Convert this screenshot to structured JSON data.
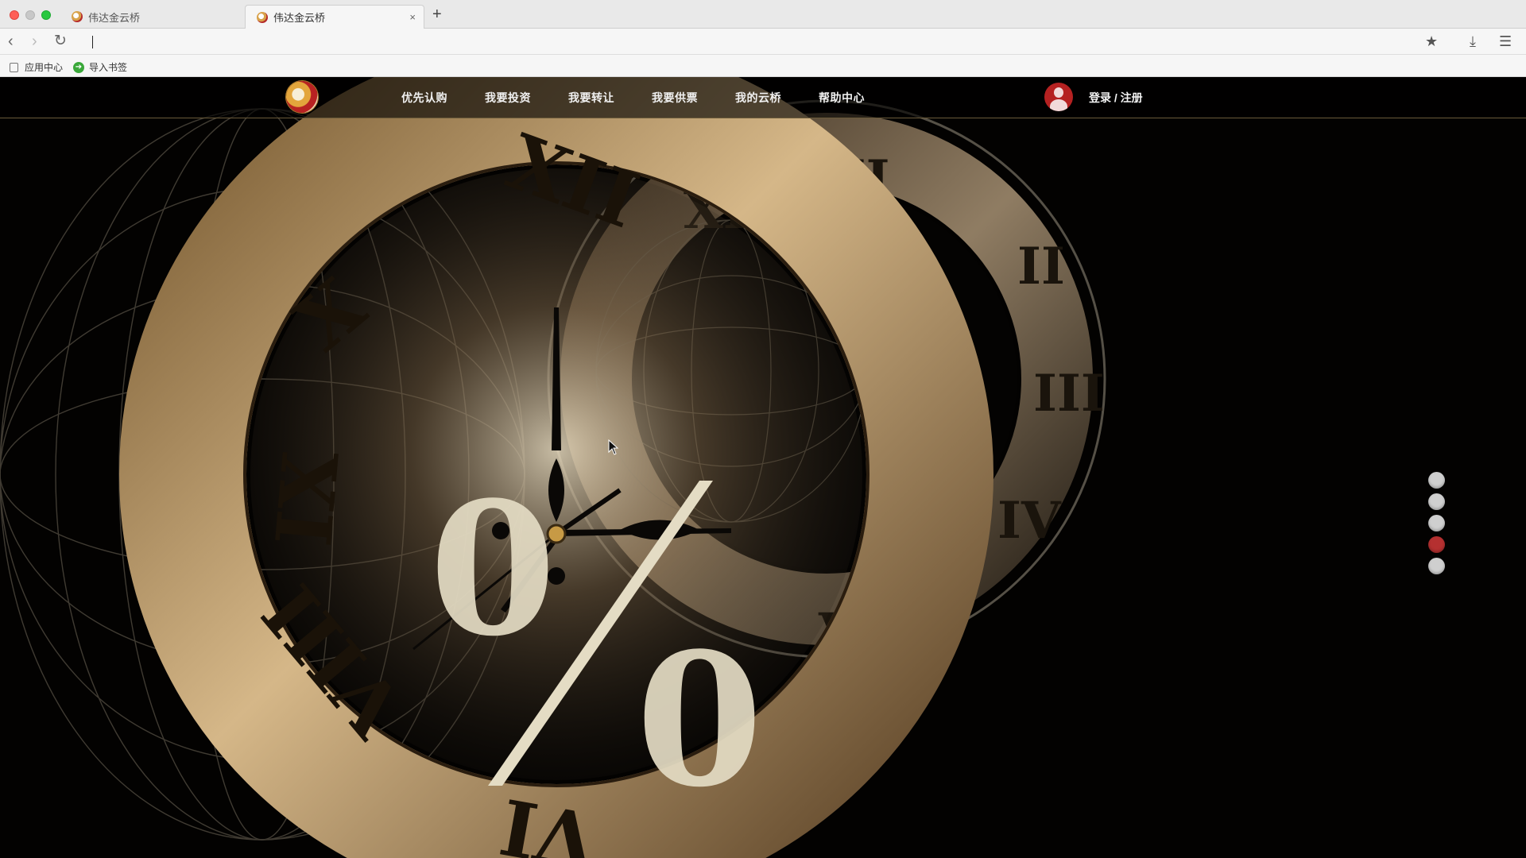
{
  "browser": {
    "tabs": [
      {
        "title": "伟达金云桥",
        "active": false
      },
      {
        "title": "伟达金云桥",
        "active": true
      }
    ],
    "tab_close": "×",
    "new_tab": "+",
    "url": "",
    "bookmarks": [
      {
        "label": "应用中心"
      },
      {
        "label": "导入书签"
      }
    ]
  },
  "site": {
    "nav": [
      "优先认购",
      "我要投资",
      "我要转让",
      "我要供票",
      "我的云桥",
      "帮助中心"
    ],
    "login_label": "登录 / 注册"
  },
  "hero": {
    "headline": "%",
    "slides_total": 5,
    "active_slide": 4
  },
  "colors": {
    "accent": "#b53030",
    "header_bg": "#000000",
    "gold": "#d8c39c"
  }
}
